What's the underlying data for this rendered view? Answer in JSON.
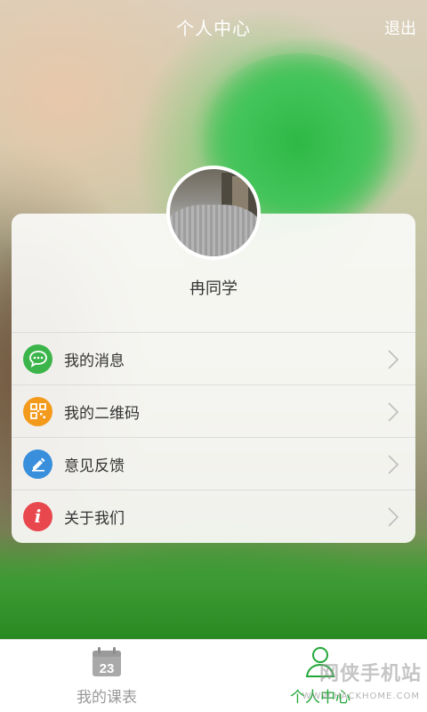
{
  "header": {
    "title": "个人中心",
    "logout_label": "退出"
  },
  "profile": {
    "username": "冉同学"
  },
  "menu": [
    {
      "label": "我的消息",
      "icon": "chat-bubble-icon",
      "color": "#3bb54a"
    },
    {
      "label": "我的二维码",
      "icon": "qr-code-icon",
      "color": "#f39a1c"
    },
    {
      "label": "意见反馈",
      "icon": "pencil-icon",
      "color": "#3a8fdc"
    },
    {
      "label": "关于我们",
      "icon": "info-icon",
      "color": "#e8474e"
    }
  ],
  "tabbar": {
    "schedule": {
      "label": "我的课表",
      "calendar_day": "23",
      "color": "#999999"
    },
    "profile": {
      "label": "个人中心",
      "color": "#22a839"
    }
  },
  "watermark": {
    "text": "网侠手机站",
    "sub": "WWW.HACKHOME.COM"
  }
}
